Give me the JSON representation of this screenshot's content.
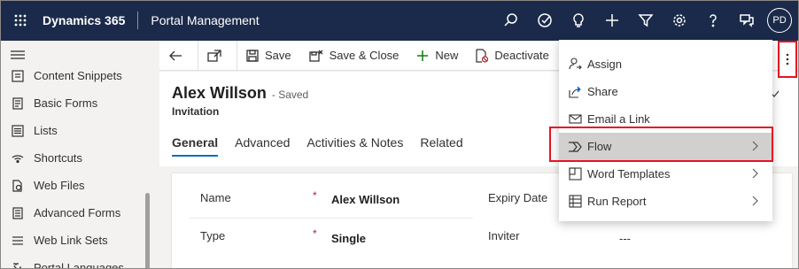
{
  "topbar": {
    "app_name": "Dynamics 365",
    "area_name": "Portal Management",
    "avatar_initials": "PD",
    "icons": [
      "search-icon",
      "task-icon",
      "lightbulb-icon",
      "plus-icon",
      "filter-icon",
      "gear-icon",
      "help-icon",
      "chat-icon"
    ]
  },
  "sidebar": {
    "items": [
      {
        "label": "Content Snippets",
        "icon": "snippet-icon"
      },
      {
        "label": "Basic Forms",
        "icon": "form-icon"
      },
      {
        "label": "Lists",
        "icon": "list-icon"
      },
      {
        "label": "Shortcuts",
        "icon": "shortcut-icon"
      },
      {
        "label": "Web Files",
        "icon": "file-icon"
      },
      {
        "label": "Advanced Forms",
        "icon": "advanced-form-icon"
      },
      {
        "label": "Web Link Sets",
        "icon": "link-set-icon"
      },
      {
        "label": "Portal Languages",
        "icon": "language-icon"
      }
    ]
  },
  "commandbar": {
    "save": "Save",
    "save_close": "Save & Close",
    "new": "New",
    "deactivate": "Deactivate",
    "delete_partial": "D"
  },
  "record": {
    "name": "Alex Willson",
    "status": "- Saved",
    "entity": "Invitation",
    "tabs": [
      "General",
      "Advanced",
      "Activities & Notes",
      "Related"
    ]
  },
  "fields": {
    "name_label": "Name",
    "name_value": "Alex Willson",
    "type_label": "Type",
    "type_value": "Single",
    "expiry_label": "Expiry Date",
    "inviter_label": "Inviter",
    "inviter_value": "---",
    "required_marker": "*"
  },
  "menu": {
    "items": [
      {
        "label": "Assign"
      },
      {
        "label": "Share"
      },
      {
        "label": "Email a Link"
      },
      {
        "label": "Flow"
      },
      {
        "label": "Word Templates"
      },
      {
        "label": "Run Report"
      }
    ]
  },
  "colors": {
    "topbar": "#1b2a4a",
    "accent": "#0f6cbd",
    "highlight": "#e81123"
  }
}
